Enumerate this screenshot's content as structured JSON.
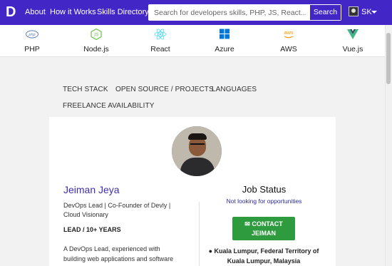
{
  "nav": {
    "logo": "D",
    "links": [
      "About",
      "How it Works",
      "Skills Directory"
    ],
    "search_placeholder": "Search for developers skills, PHP, JS, React...",
    "search_button": "Search",
    "user_initials": "SK"
  },
  "skills": [
    {
      "label": "PHP",
      "icon": "php-icon",
      "color": "#6181b6"
    },
    {
      "label": "Node.js",
      "icon": "nodejs-icon",
      "color": "#6cc24a"
    },
    {
      "label": "React",
      "icon": "react-icon",
      "color": "#61dafb"
    },
    {
      "label": "Azure",
      "icon": "azure-icon",
      "color": "#0078d4"
    },
    {
      "label": "AWS",
      "icon": "aws-icon",
      "color": "#ff9900"
    },
    {
      "label": "Vue.js",
      "icon": "vuejs-icon",
      "color": "#41b883"
    }
  ],
  "tabs": [
    "TECH STACK",
    "OPEN SOURCE / PROJECTS",
    "LANGUAGES",
    "FREELANCE AVAILABILITY"
  ],
  "profile": {
    "name": "Jeiman Jeya",
    "title_lines": [
      "DevOps Lead | Co-Founder of Devly |",
      "Cloud Visionary"
    ],
    "level": "LEAD / 10+ YEARS",
    "bio_lines": [
      "A DevOps Lead, experienced with",
      "building web applications and software"
    ]
  },
  "job": {
    "heading": "Job Status",
    "status": "Not looking for opportunities",
    "contact_line1": "CONTACT",
    "contact_line2": "JEIMAN",
    "location_lines": [
      "Kuala Lumpur, Federal Territory of",
      "Kuala Lumpur, Malaysia"
    ]
  },
  "colors": {
    "brand": "#4327c6",
    "accent_name": "#3d2fb0",
    "contact_green": "#2e9b3e"
  }
}
